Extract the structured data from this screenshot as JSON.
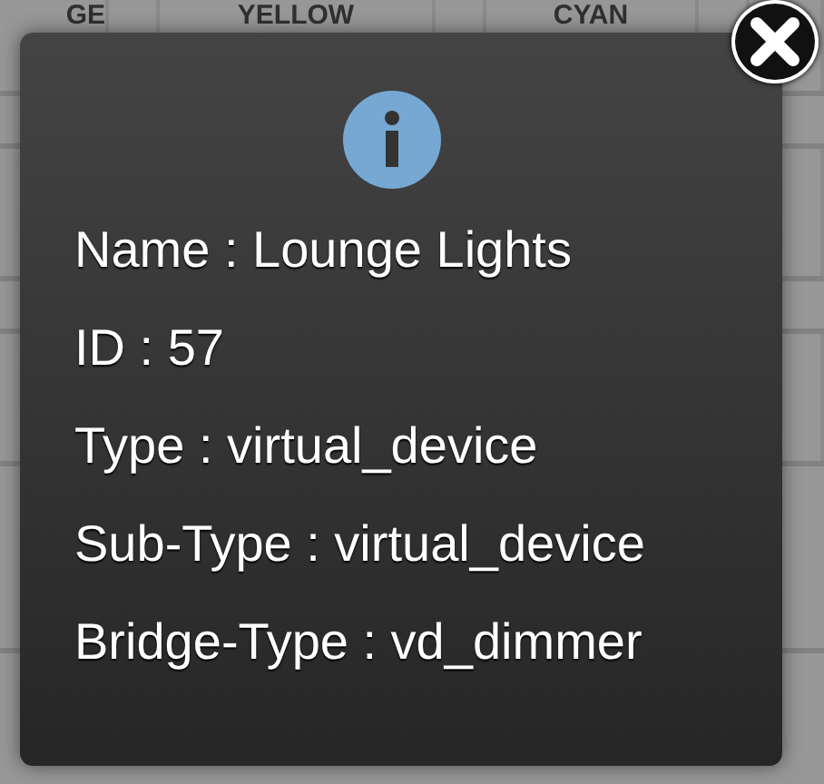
{
  "background_grid": {
    "headers": [
      "GE",
      "YELLOW",
      "CYAN"
    ]
  },
  "dialog": {
    "lines": [
      {
        "text": "Name : Lounge Lights"
      },
      {
        "text": "ID : 57"
      },
      {
        "text": "Type : virtual_device"
      },
      {
        "text": "Sub-Type : virtual_device"
      },
      {
        "text": "Bridge-Type : vd_dimmer"
      }
    ]
  }
}
